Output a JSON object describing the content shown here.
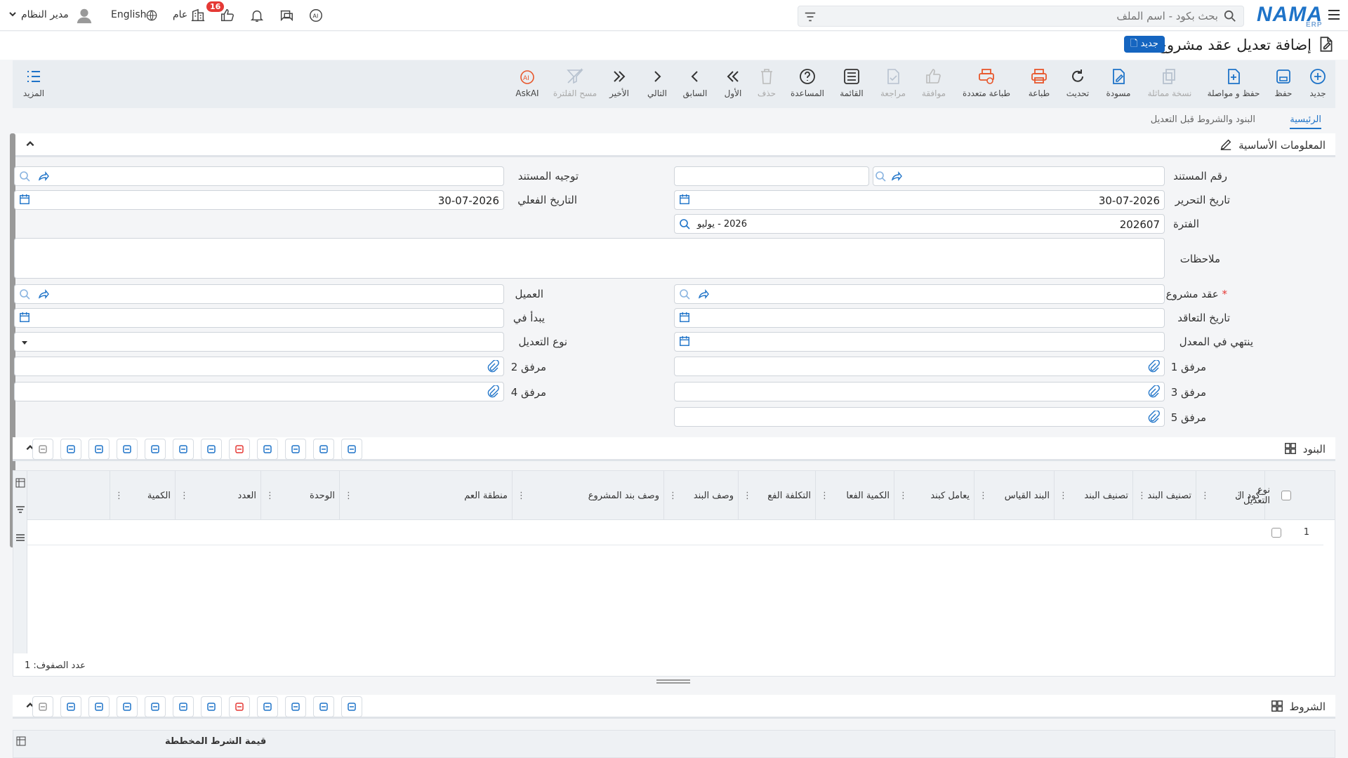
{
  "topbar": {
    "search_placeholder": "بحث بكود - اسم الملف",
    "logo": "NAMA",
    "logo_sub": "ERP",
    "user_name": "مدير النظام",
    "language": "English",
    "scope": "عام",
    "notification_count": "16"
  },
  "page": {
    "title": "إضافة تعديل عقد مشروع",
    "new_badge": "جديد"
  },
  "toolbar": [
    {
      "label": "جديد",
      "icon": "plus-circle-icon"
    },
    {
      "label": "حفظ",
      "icon": "save-icon"
    },
    {
      "label": "حفظ و مواصلة",
      "icon": "save-continue-icon"
    },
    {
      "label": "نسخة مماثلة",
      "icon": "copy-icon"
    },
    {
      "label": "مسودة",
      "icon": "draft-icon"
    },
    {
      "label": "تحديث",
      "icon": "refresh-icon"
    },
    {
      "label": "طباعة",
      "icon": "print-icon"
    },
    {
      "label": "طباعة متعددة",
      "icon": "multi-print-icon"
    },
    {
      "label": "موافقة",
      "icon": "approve-icon"
    },
    {
      "label": "مراجعة",
      "icon": "review-icon"
    },
    {
      "label": "القائمة",
      "icon": "list-icon"
    },
    {
      "label": "المساعدة",
      "icon": "help-icon"
    },
    {
      "label": "حذف",
      "icon": "delete-icon"
    },
    {
      "label": "الأول",
      "icon": "first-icon"
    },
    {
      "label": "السابق",
      "icon": "previous-icon"
    },
    {
      "label": "التالي",
      "icon": "next-icon"
    },
    {
      "label": "الأخير",
      "icon": "last-icon"
    },
    {
      "label": "مسح الفلترة",
      "icon": "clear-filter-icon"
    },
    {
      "label": "AskAI",
      "icon": "ai-icon"
    }
  ],
  "toolbar_more": "المزيد",
  "tabs": [
    "الرئيسية",
    "البنود والشروط قبل التعديل"
  ],
  "sections": {
    "basic_info": "المعلومات الأساسية",
    "items": "البنود",
    "conditions": "الشروط"
  },
  "form": {
    "doc_number_label": "رقم المستند",
    "doc_direction_label": "توجيه المستند",
    "edit_date_label": "تاريخ التحرير",
    "edit_date_value": "30-07-2026",
    "actual_date_label": "التاريخ الفعلي",
    "actual_date_value": "30-07-2026",
    "period_label": "الفترة",
    "period_value": "202607",
    "period_name": "2026 - يوليو",
    "notes_label": "ملاحظات",
    "project_contract_label": "عقد مشروع",
    "customer_label": "العميل",
    "contract_date_label": "تاريخ التعاقد",
    "starts_at_label": "يبدأ في",
    "ends_at_label": "ينتهي في المعدل",
    "amendment_type_label": "نوع التعديل",
    "attachment1_label": "مرفق 1",
    "attachment2_label": "مرفق 2",
    "attachment3_label": "مرفق 3",
    "attachment4_label": "مرفق 4",
    "attachment5_label": "مرفق 5"
  },
  "items_grid": {
    "columns": [
      "نوع التعديل",
      "كود ال",
      "تصنيف البند",
      "تصنيف البند",
      "البند القياس",
      "يعامل كبند",
      "الكمية الفعا",
      "التكلفة الفع",
      "وصف البند",
      "وصف بند المشروع",
      "منطقة العم",
      "الوحدة",
      "العدد",
      "الكمية"
    ],
    "row_number": "1",
    "row_count": "عدد الصفوف: 1"
  },
  "conditions_grid": {
    "visible_header": "قيمة الشرط المخططة"
  }
}
